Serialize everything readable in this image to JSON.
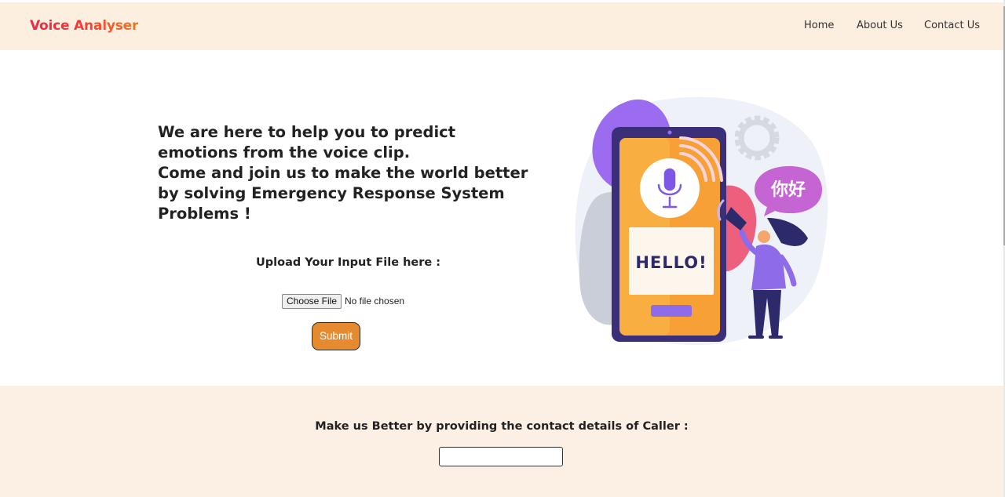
{
  "brand": {
    "name": "Voice Analyser"
  },
  "nav": {
    "home": "Home",
    "about": "About Us",
    "contact": "Contact Us"
  },
  "hero": {
    "lines": [
      "We are here to help you to predict",
      "emotions from the voice clip.",
      "Come and join us to make the world better",
      "by solving Emergency Response System",
      "Problems !"
    ]
  },
  "upload": {
    "label": "Upload Your Input File here :",
    "choose_file": "Choose File",
    "no_file": "No file chosen",
    "submit": "Submit"
  },
  "illustration": {
    "speech_bubble_text": "你好",
    "phone_screen_text": "HELLO!"
  },
  "footer": {
    "label": "Make us Better by providing the contact details of Caller :",
    "input_value": ""
  },
  "colors": {
    "navbar_bg": "#fdefdf",
    "footer_bg": "#fcf0e4",
    "brand_gradient_start": "#f0233f",
    "brand_gradient_end": "#f2761d",
    "submit_bg": "#e58a2f",
    "purple": "#9b6cf0",
    "pink": "#ea5d7f",
    "orange": "#f7a035"
  }
}
